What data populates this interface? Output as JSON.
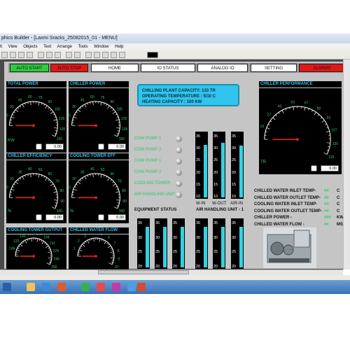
{
  "window": {
    "title": "phics Builder - [Laxmi Sracks_25082015_01 - MENU]"
  },
  "menu": [
    "lt",
    "View",
    "Objects",
    "Text",
    "Arrange",
    "Tools",
    "Window",
    "Help"
  ],
  "nav": {
    "auto_start": "AUTO START",
    "auto_stop": "AUTO STOP",
    "home": "HOME",
    "io_status": "IO STATUS",
    "analog_io": "ANALOG IO",
    "setting": "SETTING",
    "alarms": "ALARMS"
  },
  "gauges": {
    "total_power": {
      "title": "TOTAL POWER",
      "unit": "KW",
      "value": "0.00",
      "ticks": [
        "15",
        "30",
        "45",
        "60",
        "75",
        "90",
        "105",
        "120",
        "135",
        "150"
      ]
    },
    "chiller_power": {
      "title": "CHILLER POWER",
      "unit": "",
      "value": "0.00",
      "ticks": [
        "15",
        "30",
        "45",
        "60",
        "75",
        "90",
        "105",
        "120",
        "135",
        "150"
      ]
    },
    "chiller_efficiency": {
      "title": "CHILLER EFFICIENCY",
      "unit": "%",
      "value": "0.00",
      "ticks": [
        "10",
        "20",
        "30",
        "40",
        "50",
        "60",
        "70",
        "80",
        "90",
        "100"
      ]
    },
    "cooling_tower_eff": {
      "title": "COOLING TOWER EFF",
      "unit": "%",
      "value": "0.00",
      "ticks": [
        "10",
        "20",
        "30",
        "40",
        "50",
        "60",
        "70",
        "80",
        "90",
        "100"
      ]
    },
    "cooling_tower_output": {
      "title": "COOLING TOWER OUTPUT",
      "unit": "",
      "value": "",
      "ticks": [
        "106",
        "123",
        "141",
        "158",
        "176",
        "194",
        "211",
        "229",
        "246",
        "256"
      ]
    },
    "chilled_water_flow": {
      "title": "CHILLED WATER FLOW",
      "unit": "",
      "value": "",
      "ticks": [
        "1",
        "2",
        "3",
        "4",
        "5",
        "6",
        "7",
        "8",
        "9",
        "10"
      ]
    },
    "chiller_performance": {
      "title": "CHILLER PERFORMANCE",
      "unit": "TR",
      "value": "0.00",
      "ticks": [
        "13",
        "27",
        "40",
        "53",
        "67",
        "80",
        "93",
        "107",
        "120",
        "133"
      ]
    }
  },
  "plant_info": {
    "capacity": "CHILLING PLANT CAPACITY: 133 TR",
    "temperature": "OPERATING TEMPERATURE : 5/10 C",
    "heating": "HEATING CAPACITY : 100 KW"
  },
  "equipment": [
    "CDW PUMP 1",
    "CDW PUMP 2",
    "CHW PUMP 1",
    "CHW PUMP 2",
    "COOLING TOWER",
    "AIR HANDLING UNIT"
  ],
  "labels": {
    "equipment_status": "EQUIPMENT STATUS",
    "ahu": "AIR HANDLING UNIT - 1",
    "w_in": "W-IN",
    "w_out": "W-OUT",
    "air_in": "AIR-IN"
  },
  "tank_ticks": [
    "35",
    "30",
    "25",
    "20",
    "15",
    "10"
  ],
  "tank_ticks_lower": [
    "35",
    "30",
    "25",
    "20"
  ],
  "tank_levels": {
    "w_in": 0.82,
    "w_out": 0.85,
    "air_in": 0.8
  },
  "stats": [
    {
      "label": "CHILLED WATER INLET TEMP-",
      "value": "##",
      "unit": "C"
    },
    {
      "label": "CHILLED WATER OUTLET TEMP-",
      "value": "##",
      "unit": "C"
    },
    {
      "label": "COOLING WATER INLET TEMP-",
      "value": "##",
      "unit": "C"
    },
    {
      "label": "COOLING WATER OUTLET TEMP-",
      "value": "##",
      "unit": "C"
    },
    {
      "label": "CHILLER POWER -",
      "value": "###",
      "unit": "KW"
    },
    {
      "label": "CHILLED WATER FLOW -",
      "value": "##",
      "unit": "MS/Hr"
    }
  ],
  "colors": {
    "accent_cyan": "#31c6f0",
    "led_green": "#2fd06a",
    "auto_start_bg": "#2ecc40",
    "stop_bg": "#e01818"
  }
}
